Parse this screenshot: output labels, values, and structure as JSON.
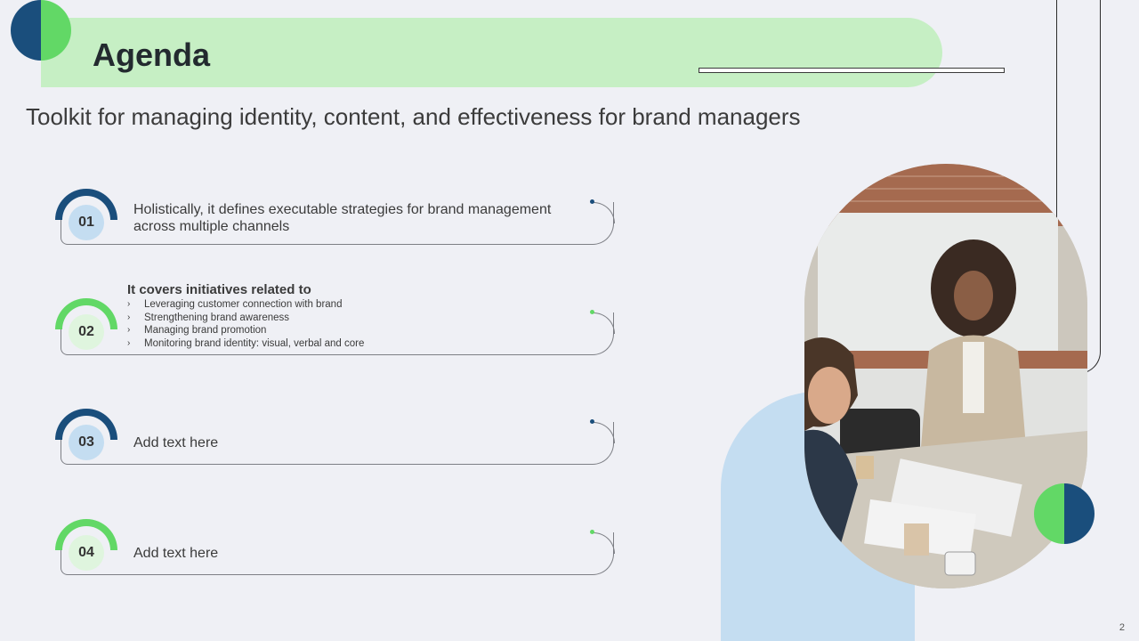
{
  "header": {
    "title": "Agenda",
    "subtitle": "Toolkit for managing identity, content, and effectiveness for brand managers"
  },
  "items": [
    {
      "number": "01",
      "text": "Holistically,  it defines executable  strategies for brand management across multiple  channels"
    },
    {
      "number": "02",
      "heading": "It covers initiatives  related to",
      "bullets": [
        "Leveraging customer connection with brand",
        "Strengthening brand awareness",
        "Managing brand promotion",
        "Monitoring brand identity: visual, verbal and core"
      ]
    },
    {
      "number": "03",
      "text": "Add text here"
    },
    {
      "number": "04",
      "text": "Add text here"
    }
  ],
  "bullet_glyph": "›",
  "page_number": "2",
  "colors": {
    "navy": "#1a4e7c",
    "green": "#62d866",
    "light_green": "#c6efc4",
    "light_blue": "#c4ddf1",
    "background": "#eff0f5"
  }
}
